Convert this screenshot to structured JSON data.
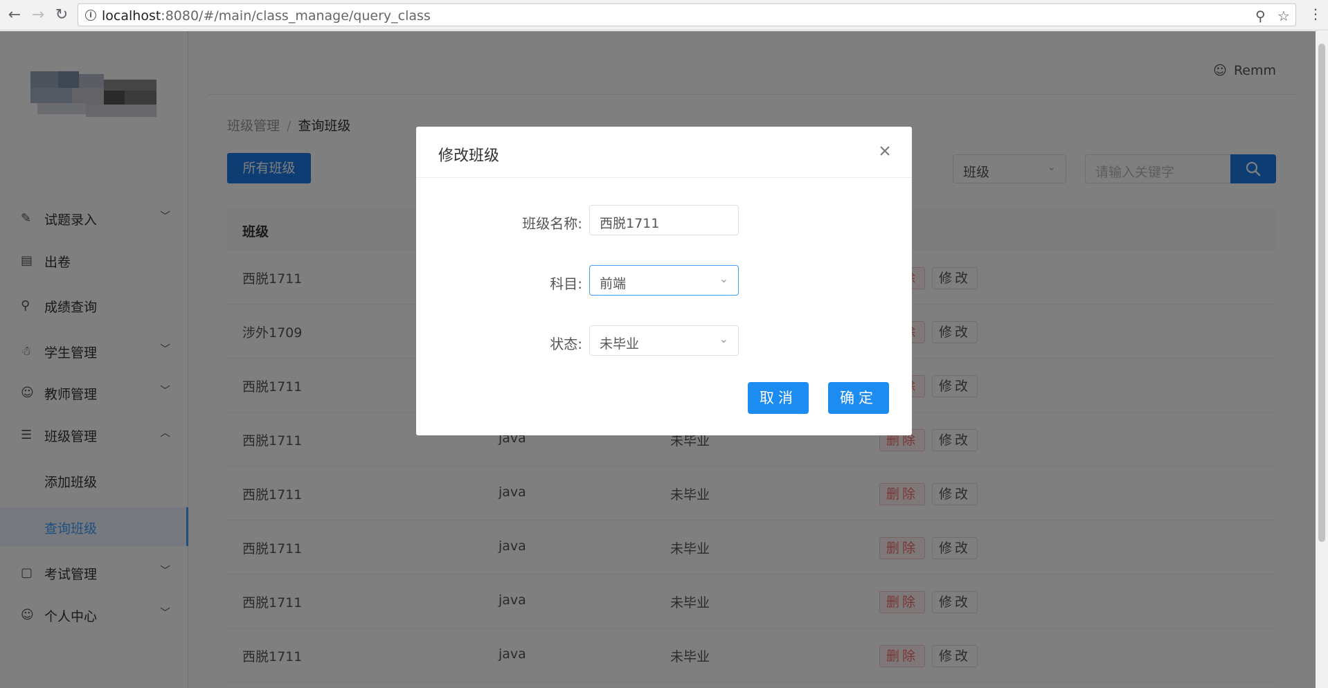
{
  "browser": {
    "url_host": "localhost",
    "url_rest": ":8080/#/main/class_manage/query_class",
    "back_icon": "arrow-left-icon",
    "forward_icon": "arrow-right-icon",
    "reload_icon": "reload-icon"
  },
  "sidebar": {
    "items": [
      {
        "label": "试题录入",
        "icon": "edit-icon",
        "arrow": "﹀"
      },
      {
        "label": "出卷",
        "icon": "list-icon",
        "arrow": ""
      },
      {
        "label": "成绩查询",
        "icon": "search-icon",
        "arrow": ""
      },
      {
        "label": "学生管理",
        "icon": "student-icon",
        "arrow": "﹀"
      },
      {
        "label": "教师管理",
        "icon": "user-icon",
        "arrow": "﹀"
      },
      {
        "label": "班级管理",
        "icon": "table-icon",
        "arrow": "︿"
      },
      {
        "label": "考试管理",
        "icon": "monitor-icon",
        "arrow": "﹀"
      },
      {
        "label": "个人中心",
        "icon": "user-icon",
        "arrow": "﹀"
      }
    ],
    "submenu": [
      {
        "label": "添加班级"
      },
      {
        "label": "查询班级"
      }
    ]
  },
  "header": {
    "user_name": "Remm"
  },
  "breadcrumb": {
    "parent": "班级管理",
    "separator": "/",
    "current": "查询班级"
  },
  "toolbar": {
    "all_classes_label": "所有班级",
    "filter_value": "班级",
    "search_placeholder": "请输入关键字"
  },
  "table": {
    "header_class": "班级",
    "delete_label": "删除",
    "edit_label": "修改",
    "rows": [
      {
        "name": "西脱1711",
        "subject": "",
        "status": ""
      },
      {
        "name": "涉外1709",
        "subject": "",
        "status": ""
      },
      {
        "name": "西脱1711",
        "subject": "",
        "status": ""
      },
      {
        "name": "西脱1711",
        "subject": "java",
        "status": "未毕业"
      },
      {
        "name": "西脱1711",
        "subject": "java",
        "status": "未毕业"
      },
      {
        "name": "西脱1711",
        "subject": "java",
        "status": "未毕业"
      },
      {
        "name": "西脱1711",
        "subject": "java",
        "status": "未毕业"
      },
      {
        "name": "西脱1711",
        "subject": "java",
        "status": "未毕业"
      }
    ]
  },
  "dialog": {
    "title": "修改班级",
    "name_label": "班级名称:",
    "name_value": "西脱1711",
    "subject_label": "科目:",
    "subject_value": "前端",
    "status_label": "状态:",
    "status_value": "未毕业",
    "cancel_label": "取消",
    "confirm_label": "确定"
  }
}
